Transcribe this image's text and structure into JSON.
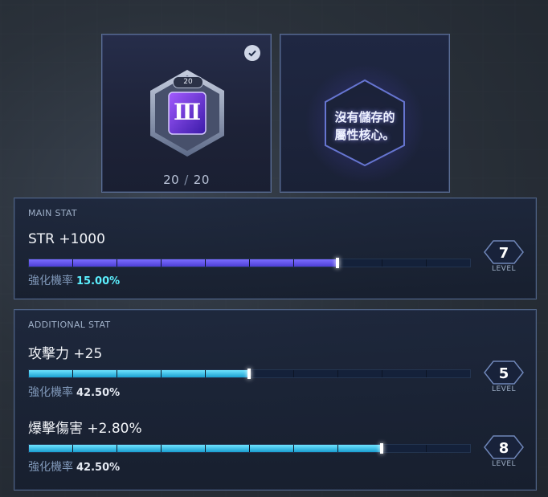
{
  "core_slot": {
    "rank_badge": "20",
    "core_numeral": "Ⅲ",
    "count_current": "20",
    "count_max": "20",
    "selected": true
  },
  "empty_slot": {
    "message_line1": "沒有儲存的",
    "message_line2": "屬性核心。"
  },
  "main_stat": {
    "section_label": "MAIN STAT",
    "stat": "STR +1000",
    "rate_label": "強化機率",
    "rate_value": "15.00%",
    "level": "7",
    "level_label": "LEVEL",
    "progress_segments_filled": 7,
    "progress_segments_total": 10
  },
  "additional_stat": {
    "section_label": "ADDITIONAL STAT",
    "stats": [
      {
        "stat": "攻擊力 +25",
        "rate_label": "強化機率",
        "rate_value": "42.50%",
        "level": "5",
        "level_label": "LEVEL",
        "progress_segments_filled": 5,
        "progress_segments_total": 10
      },
      {
        "stat": "爆擊傷害 +2.80%",
        "rate_label": "強化機率",
        "rate_value": "42.50%",
        "level": "8",
        "level_label": "LEVEL",
        "progress_segments_filled": 8,
        "progress_segments_total": 10
      }
    ]
  },
  "colors": {
    "main_bar": "#6a5cf0",
    "additional_bar": "#3cc6ee",
    "rate_highlight": "#5cf0ff"
  }
}
